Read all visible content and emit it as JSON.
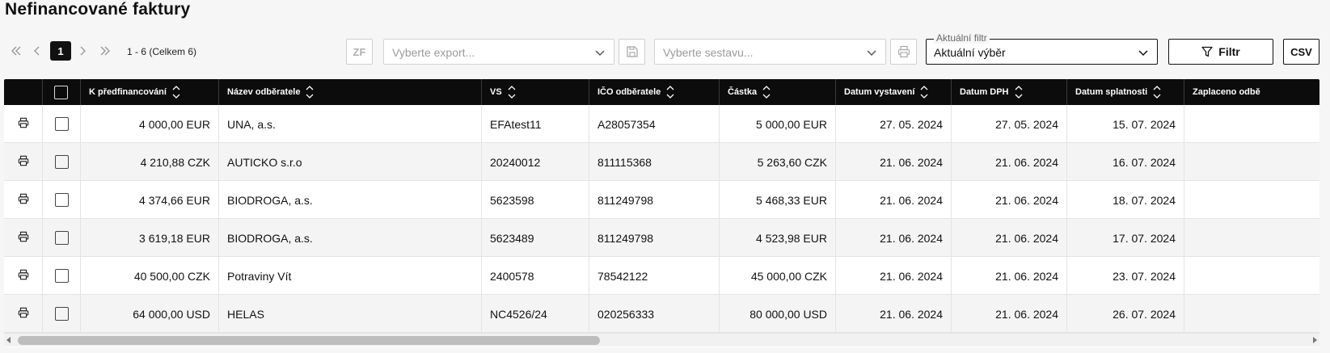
{
  "page": {
    "title": "Nefinancované faktury"
  },
  "pagination": {
    "current": "1",
    "range": "1 - 6 (Celkem 6)"
  },
  "toolbar": {
    "zf_label": "ZF",
    "export_placeholder": "Vyberte export...",
    "sestava_placeholder": "Vyberte sestavu...",
    "filter_legend": "Aktuální filtr",
    "filter_value": "Aktuální výběr",
    "filtr_label": "Filtr",
    "csv_label": "CSV"
  },
  "table": {
    "columns": [
      "K předfinancování",
      "Název odběratele",
      "VS",
      "IČO odběratele",
      "Částka",
      "Datum vystavení",
      "Datum DPH",
      "Datum splatnosti",
      "Zaplaceno odbě"
    ],
    "rows": [
      [
        "4 000,00 EUR",
        "UNA, a.s.",
        "EFAtest11",
        "A28057354",
        "5 000,00 EUR",
        "27. 05. 2024",
        "27. 05. 2024",
        "15. 07. 2024",
        ""
      ],
      [
        "4 210,88 CZK",
        "AUTICKO s.r.o",
        "20240012",
        "811115368",
        "5 263,60 CZK",
        "21. 06. 2024",
        "21. 06. 2024",
        "16. 07. 2024",
        ""
      ],
      [
        "4 374,66 EUR",
        "BIODROGA, a.s.",
        "5623598",
        "811249798",
        "5 468,33 EUR",
        "21. 06. 2024",
        "21. 06. 2024",
        "18. 07. 2024",
        ""
      ],
      [
        "3 619,18 EUR",
        "BIODROGA, a.s.",
        "5623489",
        "811249798",
        "4 523,98 EUR",
        "21. 06. 2024",
        "21. 06. 2024",
        "17. 07. 2024",
        ""
      ],
      [
        "40 500,00 CZK",
        "Potraviny Vít",
        "2400578",
        "78542122",
        "45 000,00 CZK",
        "21. 06. 2024",
        "21. 06. 2024",
        "23. 07. 2024",
        ""
      ],
      [
        "64 000,00 USD",
        "HELAS",
        "NC4526/24",
        "020256333",
        "80 000,00 USD",
        "21. 06. 2024",
        "21. 06. 2024",
        "26. 07. 2024",
        ""
      ]
    ]
  }
}
